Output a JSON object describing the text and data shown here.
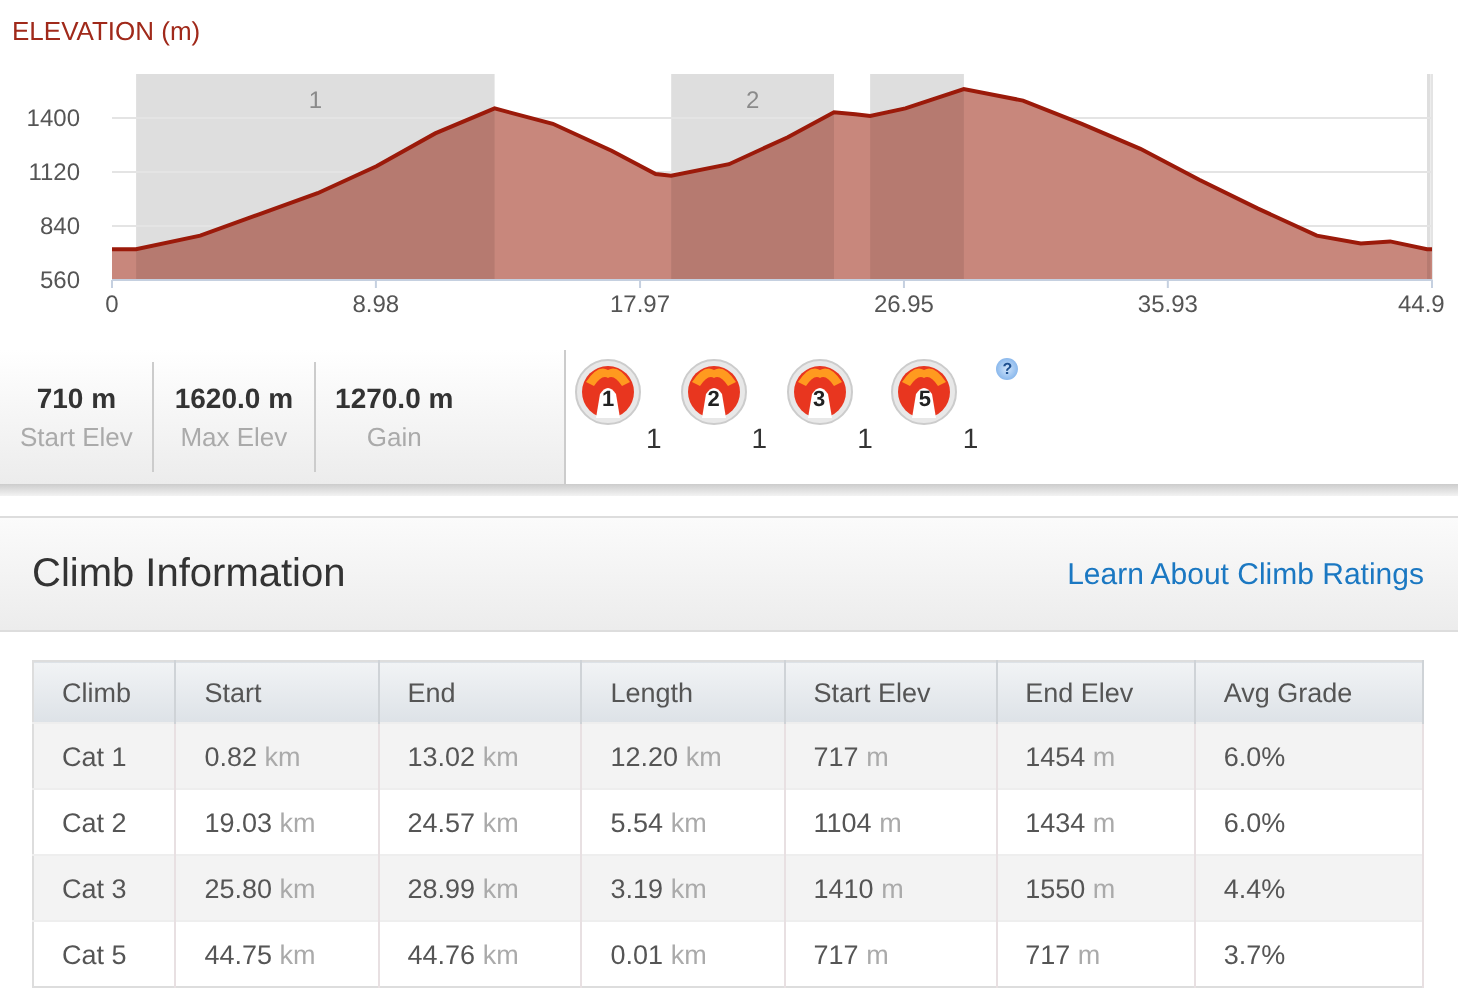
{
  "chart": {
    "title": "ELEVATION (m)",
    "chart_data": {
      "type": "area",
      "x": [
        0,
        0.82,
        3,
        5,
        7,
        9,
        11,
        13.02,
        15,
        17,
        18.5,
        19.03,
        21,
        23,
        24.57,
        25.3,
        25.8,
        27,
        28.99,
        31,
        33,
        35,
        37,
        39,
        41,
        42.5,
        43.5,
        44.75,
        44.92
      ],
      "series": [
        {
          "color": "#c8877c",
          "values": [
            720,
            720,
            790,
            900,
            1010,
            1150,
            1320,
            1450,
            1370,
            1230,
            1110,
            1100,
            1160,
            1300,
            1430,
            1420,
            1410,
            1450,
            1550,
            1490,
            1370,
            1240,
            1080,
            930,
            790,
            750,
            760,
            720,
            720
          ]
        }
      ],
      "grid": true,
      "xlim": [
        0,
        44.92
      ],
      "ylim": [
        560,
        1628
      ],
      "xticks": [
        0,
        8.98,
        17.97,
        26.95,
        35.93,
        {
          "value": 44.92,
          "label": "44.9"
        }
      ],
      "yticks": [
        560,
        840,
        1120,
        1400
      ]
    },
    "band_labels": [
      "1",
      "2"
    ]
  },
  "stats": [
    {
      "value": "710 m",
      "label": "Start Elev"
    },
    {
      "value": "1620.0 m",
      "label": "Max Elev"
    },
    {
      "value": "1270.0 m",
      "label": "Gain"
    }
  ],
  "badges": [
    {
      "category": "1",
      "count": "1"
    },
    {
      "category": "2",
      "count": "1"
    },
    {
      "category": "3",
      "count": "1"
    },
    {
      "category": "5",
      "count": "1"
    }
  ],
  "help": "?",
  "section": {
    "title": "Climb Information",
    "link": "Learn About Climb Ratings"
  },
  "table": {
    "columns": [
      "Climb",
      "Start",
      "End",
      "Length",
      "Start Elev",
      "End Elev",
      "Avg Grade"
    ],
    "rows": [
      [
        {
          "value": "Cat 1"
        },
        {
          "value": "0.82",
          "unit": "km"
        },
        {
          "value": "13.02",
          "unit": "km"
        },
        {
          "value": "12.20",
          "unit": "km"
        },
        {
          "value": "717",
          "unit": "m"
        },
        {
          "value": "1454",
          "unit": "m"
        },
        {
          "value": "6.0%"
        }
      ],
      [
        {
          "value": "Cat 2"
        },
        {
          "value": "19.03",
          "unit": "km"
        },
        {
          "value": "24.57",
          "unit": "km"
        },
        {
          "value": "5.54",
          "unit": "km"
        },
        {
          "value": "1104",
          "unit": "m"
        },
        {
          "value": "1434",
          "unit": "m"
        },
        {
          "value": "6.0%"
        }
      ],
      [
        {
          "value": "Cat 3"
        },
        {
          "value": "25.80",
          "unit": "km"
        },
        {
          "value": "28.99",
          "unit": "km"
        },
        {
          "value": "3.19",
          "unit": "km"
        },
        {
          "value": "1410",
          "unit": "m"
        },
        {
          "value": "1550",
          "unit": "m"
        },
        {
          "value": "4.4%"
        }
      ],
      [
        {
          "value": "Cat 5"
        },
        {
          "value": "44.75",
          "unit": "km"
        },
        {
          "value": "44.76",
          "unit": "km"
        },
        {
          "value": "0.01",
          "unit": "km"
        },
        {
          "value": "717",
          "unit": "m"
        },
        {
          "value": "717",
          "unit": "m"
        },
        {
          "value": "3.7%"
        }
      ]
    ]
  }
}
